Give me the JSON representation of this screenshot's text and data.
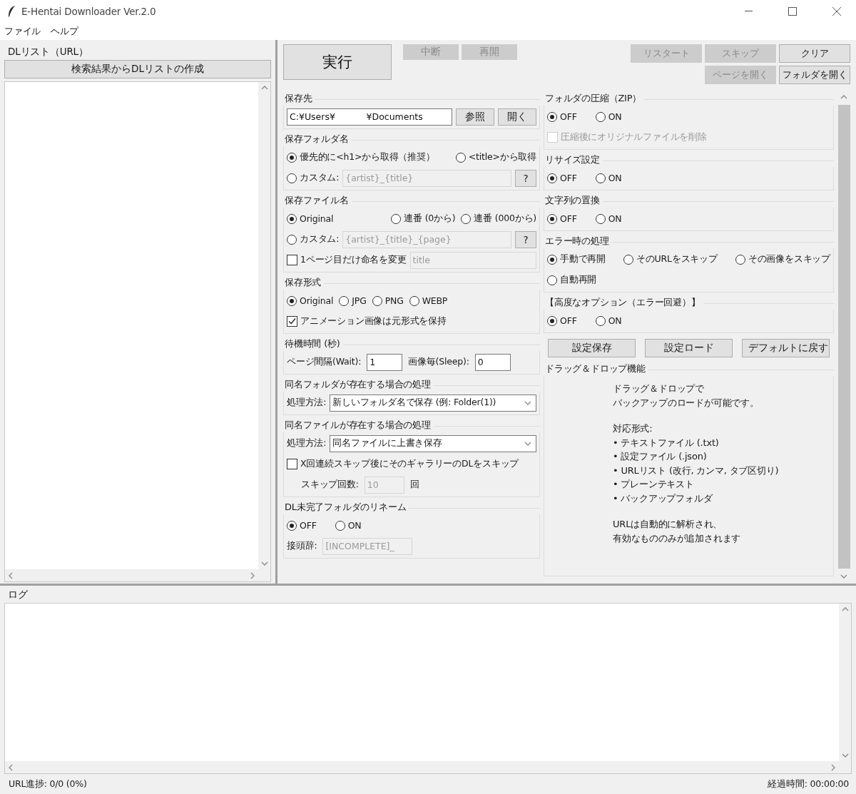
{
  "window": {
    "title": "E-Hentai Downloader Ver.2.0"
  },
  "menu": [
    {
      "label": "ファイル"
    },
    {
      "label": "ヘルプ"
    }
  ],
  "dl_list": {
    "title": "DLリスト（URL）",
    "button": "検索結果からDLリストの作成"
  },
  "toolbar": {
    "run": {
      "label": "実行",
      "disabled": false
    },
    "left_buttons": [
      {
        "label": "中断",
        "disabled": true
      },
      {
        "label": "再開",
        "disabled": true
      }
    ],
    "right_row_1": [
      {
        "label": "リスタート",
        "disabled": true
      },
      {
        "label": "スキップ",
        "disabled": true
      },
      {
        "label": "クリア",
        "disabled": false
      }
    ],
    "right_row_2": [
      {
        "label": "ページを開く",
        "disabled": true
      },
      {
        "label": "フォルダを開く",
        "disabled": false
      }
    ]
  },
  "left_sections": [
    {
      "title": "保存先",
      "rows": [
        {
          "kind": "fill",
          "items": [
            {
              "kind": "field",
              "value": "C:¥Users¥           ¥Documents",
              "disabled": false
            },
            {
              "kind": "button",
              "label": "参照"
            },
            {
              "kind": "button",
              "label": "開く"
            }
          ]
        }
      ]
    },
    {
      "title": "保存フォルダ名",
      "rows": [
        {
          "kind": "spread",
          "items": [
            {
              "kind": "radio",
              "label": "優先的に<h1>から取得（推奨）",
              "selected": true
            },
            {
              "kind": "radio",
              "label": "<title>から取得",
              "selected": false
            }
          ]
        },
        {
          "kind": "fill",
          "items": [
            {
              "kind": "radio",
              "label": "カスタム:",
              "selected": false
            },
            {
              "kind": "field",
              "value": "{artist}_{title}",
              "disabled": true
            },
            {
              "kind": "help",
              "label": "?"
            }
          ]
        }
      ]
    },
    {
      "title": "保存ファイル名",
      "rows": [
        {
          "kind": "spread",
          "items": [
            {
              "kind": "radio",
              "label": "Original",
              "selected": true
            },
            {
              "kind": "radio",
              "label": "連番 (0から)",
              "selected": false
            },
            {
              "kind": "radio",
              "label": "連番 (000から)",
              "selected": false
            }
          ]
        },
        {
          "kind": "fill",
          "items": [
            {
              "kind": "radio",
              "label": "カスタム:",
              "selected": false
            },
            {
              "kind": "field",
              "value": "{artist}_{title}_{page}",
              "disabled": true
            },
            {
              "kind": "help",
              "label": "?"
            }
          ]
        },
        {
          "kind": "fill",
          "items": [
            {
              "kind": "checkbox",
              "label": "1ページ目だけ命名を変更",
              "checked": false,
              "disabled": false
            },
            {
              "kind": "field",
              "value": "title",
              "disabled": true
            }
          ]
        }
      ]
    },
    {
      "title": "保存形式",
      "rows": [
        {
          "kind": "inline",
          "items": [
            {
              "kind": "radio",
              "label": "Original",
              "selected": true
            },
            {
              "kind": "radio",
              "label": "JPG",
              "selected": false
            },
            {
              "kind": "radio",
              "label": "PNG",
              "selected": false
            },
            {
              "kind": "radio",
              "label": "WEBP",
              "selected": false
            }
          ]
        },
        {
          "kind": "inline",
          "items": [
            {
              "kind": "checkbox",
              "label": "アニメーション画像は元形式を保持",
              "checked": true,
              "disabled": false
            }
          ]
        }
      ]
    },
    {
      "title": "待機時間 (秒)",
      "rows": [
        {
          "kind": "inline",
          "items": [
            {
              "kind": "label",
              "text": "ページ間隔(Wait):"
            },
            {
              "kind": "field",
              "value": "1",
              "disabled": false
            },
            {
              "kind": "label",
              "text": "画像毎(Sleep):"
            },
            {
              "kind": "field",
              "value": "0",
              "disabled": false
            }
          ]
        }
      ]
    },
    {
      "title": "同名フォルダが存在する場合の処理",
      "rows": [
        {
          "kind": "fill",
          "items": [
            {
              "kind": "label",
              "text": "処理方法:"
            },
            {
              "kind": "select",
              "value": "新しいフォルダ名で保存 (例: Folder(1))"
            }
          ]
        }
      ]
    },
    {
      "title": "同名ファイルが存在する場合の処理",
      "rows": [
        {
          "kind": "fill",
          "items": [
            {
              "kind": "label",
              "text": "処理方法:"
            },
            {
              "kind": "select",
              "value": "同名ファイルに上書き保存"
            }
          ]
        },
        {
          "kind": "inline",
          "items": [
            {
              "kind": "checkbox",
              "label": "X回連続スキップ後にそのギャラリーのDLをスキップ",
              "checked": false,
              "disabled": false
            }
          ]
        },
        {
          "kind": "indent",
          "items": [
            {
              "kind": "label",
              "text": "スキップ回数:"
            },
            {
              "kind": "field",
              "value": "10",
              "disabled": true
            },
            {
              "kind": "label",
              "text": "回"
            }
          ]
        }
      ]
    },
    {
      "title": "DL未完了フォルダのリネーム",
      "rows": [
        {
          "kind": "toggle",
          "items": [
            {
              "kind": "radio",
              "label": "OFF",
              "selected": true
            },
            {
              "kind": "radio",
              "label": "ON",
              "selected": false
            }
          ]
        },
        {
          "kind": "inline",
          "items": [
            {
              "kind": "label",
              "text": "接頭辞:"
            },
            {
              "kind": "field",
              "value": "[INCOMPLETE]_",
              "disabled": true
            }
          ]
        }
      ]
    }
  ],
  "right_sections": [
    {
      "title": "フォルダの圧縮（ZIP）",
      "rows": [
        {
          "kind": "toggle",
          "items": [
            {
              "kind": "radio",
              "label": "OFF",
              "selected": true
            },
            {
              "kind": "radio",
              "label": "ON",
              "selected": false
            }
          ]
        },
        {
          "kind": "inline",
          "items": [
            {
              "kind": "checkbox",
              "label": "圧縮後にオリジナルファイルを削除",
              "checked": false,
              "disabled": true
            }
          ]
        }
      ]
    },
    {
      "title": "リサイズ設定",
      "rows": [
        {
          "kind": "toggle",
          "items": [
            {
              "kind": "radio",
              "label": "OFF",
              "selected": true
            },
            {
              "kind": "radio",
              "label": "ON",
              "selected": false
            }
          ]
        }
      ]
    },
    {
      "title": "文字列の置換",
      "rows": [
        {
          "kind": "toggle",
          "items": [
            {
              "kind": "radio",
              "label": "OFF",
              "selected": true
            },
            {
              "kind": "radio",
              "label": "ON",
              "selected": false
            }
          ]
        }
      ]
    },
    {
      "title": "エラー時の処理",
      "rows": [
        {
          "kind": "justify",
          "items": [
            {
              "kind": "radio",
              "label": "手動で再開",
              "selected": true
            },
            {
              "kind": "radio",
              "label": "そのURLをスキップ",
              "selected": false
            },
            {
              "kind": "radio",
              "label": "その画像をスキップ",
              "selected": false
            }
          ]
        },
        {
          "kind": "inline",
          "items": [
            {
              "kind": "radio",
              "label": "自動再開",
              "selected": false
            }
          ]
        }
      ]
    },
    {
      "title": "【高度なオプション（エラー回避）】",
      "rows": [
        {
          "kind": "toggle",
          "items": [
            {
              "kind": "radio",
              "label": "OFF",
              "selected": true
            },
            {
              "kind": "radio",
              "label": "ON",
              "selected": false
            }
          ]
        }
      ]
    }
  ],
  "settings_buttons": [
    {
      "label": "設定保存"
    },
    {
      "label": "設定ロード"
    },
    {
      "label": "デフォルトに戻す"
    }
  ],
  "drag_drop": {
    "title": "ドラッグ＆ドロップ機能",
    "paragraphs": [
      [
        "ドラッグ＆ドロップで",
        "バックアップのロードが可能です。"
      ],
      [
        "対応形式:",
        "• テキストファイル (.txt)",
        "• 設定ファイル (.json)",
        "• URLリスト (改行, カンマ, タブ区切り)",
        "• プレーンテキスト",
        "• バックアップフォルダ"
      ],
      [
        "URLは自動的に解析され、",
        "有効なもののみが追加されます"
      ]
    ]
  },
  "log": {
    "title": "ログ"
  },
  "status_bar": {
    "progress": "URL進捗: 0/0 (0%)",
    "elapsed": "経過時間: 00:00:00"
  }
}
